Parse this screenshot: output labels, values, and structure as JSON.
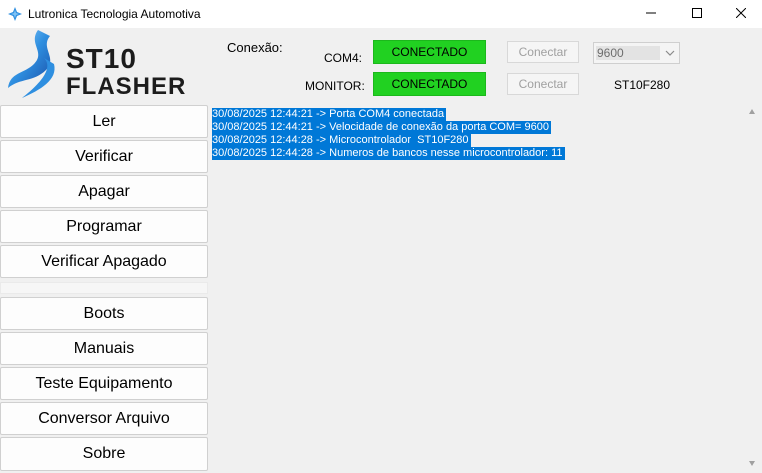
{
  "window": {
    "title": "Lutronica Tecnologia Automotiva",
    "controls": {
      "minimize_icon": "minimize-icon",
      "maximize_icon": "maximize-icon",
      "close_icon": "close-icon"
    }
  },
  "logo": {
    "line1": "ST10",
    "line2": "FLASHER",
    "accent": "#2f8fe0"
  },
  "connection": {
    "label": "Conexão:",
    "com": {
      "port_label": "COM4:",
      "status": "CONECTADO",
      "button": "Conectar"
    },
    "monitor": {
      "port_label": "MONITOR:",
      "status": "CONECTADO",
      "button": "Conectar"
    },
    "baud_rate": "9600",
    "microcontroller": "ST10F280",
    "status_color": "#21d121"
  },
  "sidebar": {
    "top_buttons": [
      "Ler",
      "Verificar",
      "Apagar",
      "Programar",
      "Verificar Apagado"
    ],
    "bottom_buttons": [
      "Boots",
      "Manuais",
      "Teste Equipamento",
      "Conversor Arquivo",
      "Sobre"
    ]
  },
  "log": {
    "highlight_color": "#0078d7",
    "lines": [
      "30/08/2025 12:44:21 -> Porta COM4 conectada",
      "30/08/2025 12:44:21 -> Velocidade de conexão da porta COM= 9600",
      "30/08/2025 12:44:28 -> Microcontrolador  ST10F280",
      "30/08/2025 12:44:28 -> Numeros de bancos nesse microcontrolador: 11"
    ]
  }
}
